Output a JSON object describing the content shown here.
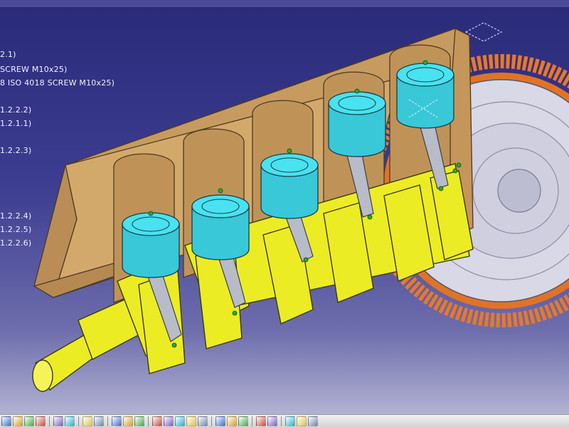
{
  "spec_tree": {
    "nodes": [
      "2.1)",
      "SCREW M10x25)",
      "8 ISO 4018 SCREW M10x25)",
      "1.2.2.2)",
      "1.2.1.1)",
      "1.2.2.3)",
      "1.2.2.4)",
      "1.2.2.5)",
      "1.2.2.6)"
    ]
  },
  "model": {
    "components": [
      "engine-block-cutaway",
      "crankshaft",
      "piston-1",
      "piston-2",
      "piston-3",
      "piston-4",
      "piston-5",
      "flywheel-ring-gear"
    ],
    "colors": {
      "block": "#d3a96b",
      "block_inner": "#bf9358",
      "crankshaft": "#ecec24",
      "piston": "#38d6e6",
      "rod": "#b7bcc8",
      "flywheel": "#d8d8e6",
      "ring_gear": "#e8782a"
    }
  },
  "toolbar": {
    "icons": [
      "select-icon",
      "zoom-icon",
      "link-icon",
      "help-icon",
      "sep",
      "fx-formula-icon",
      "catalog-icon",
      "sep",
      "new-part-icon",
      "bolt-icon",
      "sep",
      "move-icon",
      "snap-icon",
      "measure-icon",
      "sep",
      "constraint-icon",
      "fix-icon",
      "contact-icon",
      "offset-icon",
      "angle-icon",
      "sep",
      "update-icon",
      "clash-icon",
      "section-icon",
      "sep",
      "explode-icon",
      "render-icon",
      "sep",
      "fly-icon",
      "rotate-icon",
      "pan-icon"
    ]
  }
}
